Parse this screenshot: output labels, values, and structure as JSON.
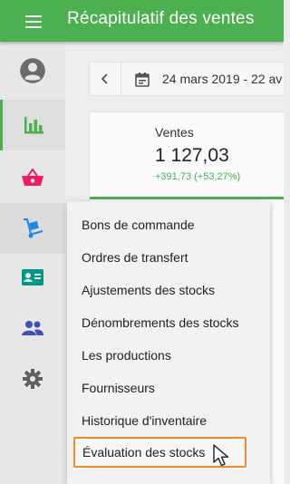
{
  "header": {
    "title": "Récapitulatif des ventes",
    "menu_icon": "hamburger-menu-icon"
  },
  "sidebar": {
    "items": [
      {
        "name": "account",
        "icon": "account-circle-icon",
        "color": "#6b6b6b"
      },
      {
        "name": "reports",
        "icon": "bar-chart-icon",
        "color": "#4caf50",
        "active": true
      },
      {
        "name": "items",
        "icon": "shopping-basket-icon",
        "color": "#e91e63"
      },
      {
        "name": "inventory",
        "icon": "dolly-icon",
        "color": "#1e88e5",
        "hover": true
      },
      {
        "name": "customers",
        "icon": "contact-card-icon",
        "color": "#009688"
      },
      {
        "name": "employees",
        "icon": "people-icon",
        "color": "#3f51b5"
      },
      {
        "name": "settings",
        "icon": "gear-icon",
        "color": "#616161"
      }
    ]
  },
  "date_range": {
    "text": "24 mars 2019 - 22 av",
    "prev_icon": "chevron-left-icon",
    "calendar_icon": "calendar-icon"
  },
  "summary": {
    "label": "Ventes",
    "value": "1 127,03",
    "delta": "+391,73 (+53,27%)"
  },
  "menu": {
    "items": [
      {
        "label": "Bons de commande"
      },
      {
        "label": "Ordres de transfert"
      },
      {
        "label": "Ajustements des stocks"
      },
      {
        "label": "Dénombrements des stocks"
      },
      {
        "label": "Les productions"
      },
      {
        "label": "Fournisseurs"
      },
      {
        "label": "Historique d'inventaire"
      },
      {
        "label": "Évaluation des stocks",
        "highlighted": true
      }
    ]
  },
  "colors": {
    "primary": "#4caf50",
    "highlight_border": "#ef8a2f"
  }
}
